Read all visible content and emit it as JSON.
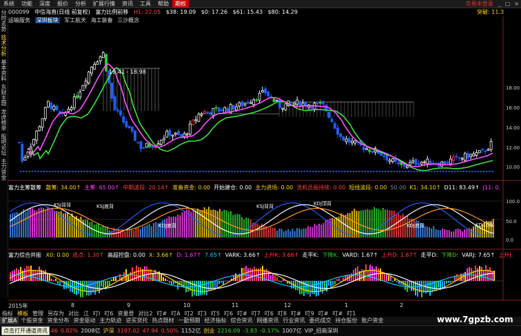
{
  "menu": {
    "items": [
      "系统",
      "功能",
      "深度",
      "报价",
      "分析",
      "扩展行情",
      "资讯",
      "工具",
      "帮助"
    ],
    "period_button": "期权",
    "right_text": "交易未登录",
    "window_controls": [
      "_",
      "□",
      "×"
    ]
  },
  "side_tabs": [
    "分时走势",
    "技术分析",
    "基本资料",
    "东财主题",
    "龙虎榜单",
    "股吧论坛",
    "主力资金"
  ],
  "title": {
    "code": "000099",
    "name": "中信海直(日线 前复权)",
    "formula": "富力比例前移",
    "values": [
      {
        "t": "H1: 22.05",
        "c": "red"
      },
      {
        "t": "$38: 19.09",
        "c": "white"
      },
      {
        "t": "$0: 17.26",
        "c": "white"
      },
      {
        "t": "$61: 15.43",
        "c": "white"
      },
      {
        "t": "$80: 14.29",
        "c": "white"
      }
    ],
    "right_label": "突破: 11.3"
  },
  "tags": [
    {
      "t": "运输服务",
      "hl": false
    },
    {
      "t": "深圳板块",
      "hl": true
    },
    {
      "t": "军工航天",
      "hl": false
    },
    {
      "t": "海工装备",
      "hl": false
    },
    {
      "t": "三沙概念",
      "hl": false
    }
  ],
  "main_annotation": "19.41 - 18.98",
  "main_axis": [
    "18.00",
    "16.00",
    "14.00",
    "12.00",
    "10.00"
  ],
  "main_axis_top": "20.00",
  "panel1": {
    "label": "富力主筹散筹",
    "values": [
      {
        "t": "散筹: 34.00↑",
        "c": "#ffd700"
      },
      {
        "t": "主筹: 65.00↑",
        "c": "#ff40ff"
      },
      {
        "t": "中期波段: 20.14↑",
        "c": "#ff4040"
      },
      {
        "t": "准备资金: 0.00",
        "c": "#ffd700"
      },
      {
        "t": "开始建仓: 0.00",
        "c": "#fff"
      },
      {
        "t": "主力进场: 0.00",
        "c": "#ffd700"
      },
      {
        "t": "洗机员振持续: 0.00",
        "c": "#ff4040"
      },
      {
        "t": "短线波段: 0.00",
        "c": "#ffd700"
      },
      {
        "t": "50.00",
        "c": "#888"
      },
      {
        "t": "K1: 34.10↑",
        "c": "#ffd700"
      },
      {
        "t": "D11: 83.49↑",
        "c": "#fff"
      },
      {
        "t": "J11: 0.",
        "c": "#ff40ff"
      }
    ],
    "axis": [
      "100.0",
      "50.0",
      "0.0"
    ],
    "annotations": [
      "KSJ背背",
      "KSJ底背",
      "KDJ底背",
      "KSJ背背",
      "KDJ顶背",
      "KDJ底背",
      "KDJ顶背"
    ]
  },
  "panel2": {
    "label": "富力综合共振",
    "values": [
      {
        "t": "X0: 0.00",
        "c": "#ffd700"
      },
      {
        "t": "逃点: 1.30↑",
        "c": "#ff4040"
      },
      {
        "t": "高超控盘: 0.00",
        "c": "#fff"
      },
      {
        "t": "X: 3.66↑",
        "c": "#ffd700"
      },
      {
        "t": "D: 1.67↑",
        "c": "#ff40ff"
      },
      {
        "t": "7.65↑",
        "c": "#00d0ff"
      },
      {
        "t": "VARK: 3.66↑",
        "c": "#fff"
      },
      {
        "t": "上升K: 3.66↑",
        "c": "#ff4040"
      },
      {
        "t": "走平K:",
        "c": "#fff"
      },
      {
        "t": "下降K:",
        "c": "#2fd32f"
      },
      {
        "t": "VARD: 1.67↑",
        "c": "#fff"
      },
      {
        "t": "上升D: 1.67↑",
        "c": "#ff4040"
      },
      {
        "t": "走平D:",
        "c": "#fff"
      },
      {
        "t": "下降D:",
        "c": "#2fd32f"
      },
      {
        "t": "VARJ: 7.65↑",
        "c": "#fff"
      },
      {
        "t": "上升J:",
        "c": "#ff4040"
      }
    ]
  },
  "x_axis": {
    "year": "2015年",
    "months": [
      "8",
      "9",
      "10",
      "11",
      "12",
      "1",
      "2"
    ]
  },
  "bottom_tabs": [
    "指标",
    "模板",
    "管理",
    "另存为",
    "对比",
    "江",
    "叮I",
    "叮6",
    "资量登",
    "对比2",
    "叮#",
    "叮A",
    "叮2",
    "叮3",
    "叮5",
    "叮6",
    "叮#",
    "叮7",
    "叮6",
    "叮8",
    "叮#",
    "叮9",
    "叮#",
    "叮#",
    "叮1"
  ],
  "bottom_tabs_active": 1,
  "bottom_tabs2": [
    "扩展A",
    "个股资金",
    "资金分布",
    "资金驱动",
    "主力轨迹",
    "逆买货托",
    "热点题材",
    "一勤预期",
    "经济指标",
    "综合资讯",
    "网播资讯",
    "行业资讯",
    "委托成交",
    "持仓股份",
    "账户资金"
  ],
  "bottom_tabs2_active": 0,
  "status": [
    {
      "t": "8.46",
      "c": "red"
    },
    {
      "t": "0.82%",
      "c": "red"
    },
    {
      "t": "2008亿",
      "c": "white"
    },
    {
      "t": "沪深",
      "c": "yellow"
    },
    {
      "t": "3197.02",
      "c": "red"
    },
    {
      "t": "47.94",
      "c": "red"
    },
    {
      "t": "0.50%",
      "c": "red"
    },
    {
      "t": "1152亿",
      "c": "white"
    },
    {
      "t": "创业",
      "c": "yellow"
    },
    {
      "t": "2216.09",
      "c": "green"
    },
    {
      "t": "-3.83",
      "c": "green"
    },
    {
      "t": "-0.17%",
      "c": "green"
    },
    {
      "t": "1007亿",
      "c": "white"
    },
    {
      "t": "VIP_招商深圳",
      "c": "white"
    }
  ],
  "tooltip": "点击打开通道资讯",
  "watermark": "www.7gpzb.com"
}
